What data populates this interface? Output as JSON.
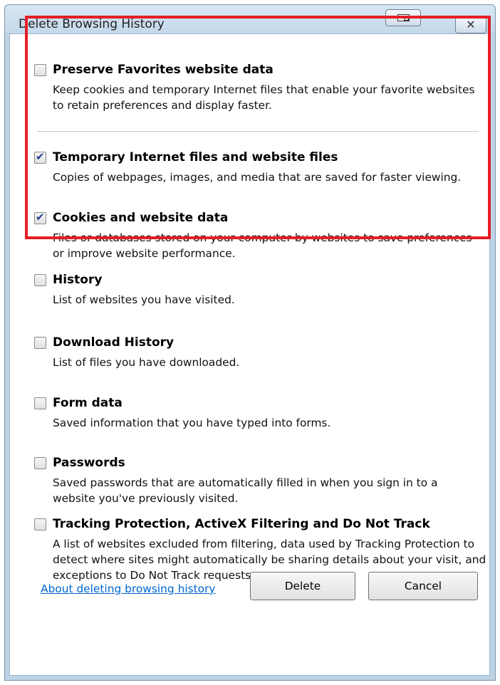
{
  "window": {
    "title": "Delete Browsing History"
  },
  "items": [
    {
      "label": "Preserve Favorites website data",
      "description": "Keep cookies and temporary Internet files that enable your favorite websites to retain preferences and display faster.",
      "checked": false
    },
    {
      "label": "Temporary Internet files and website files",
      "description": "Copies of webpages, images, and media that are saved for faster viewing.",
      "checked": true
    },
    {
      "label": "Cookies and website data",
      "description": "Files or databases stored on your computer by websites to save preferences or improve website performance.",
      "checked": true
    },
    {
      "label": "History",
      "description": "List of websites you have visited.",
      "checked": false
    },
    {
      "label": "Download History",
      "description": "List of files you have downloaded.",
      "checked": false
    },
    {
      "label": "Form data",
      "description": "Saved information that you have typed into forms.",
      "checked": false
    },
    {
      "label": "Passwords",
      "description": "Saved passwords that are automatically filled in when you sign in to a website you've previously visited.",
      "checked": false
    },
    {
      "label": "Tracking Protection, ActiveX Filtering and Do Not Track",
      "description": "A list of websites excluded from filtering, data used by Tracking Protection to detect where sites might automatically be sharing details about your visit, and exceptions to Do Not Track requests.",
      "checked": false
    }
  ],
  "footer": {
    "link_text": "About deleting browsing history",
    "delete_label": "Delete",
    "cancel_label": "Cancel"
  },
  "colors": {
    "highlight": "#e51e24",
    "link": "#0066cc",
    "checkmark": "#1d3f8c"
  }
}
